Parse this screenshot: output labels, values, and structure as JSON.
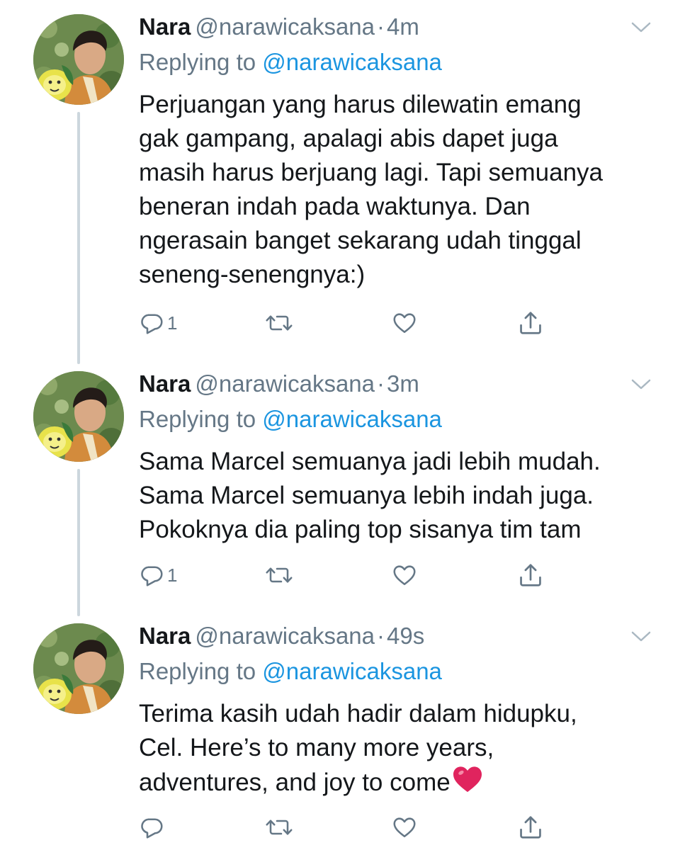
{
  "tweets": [
    {
      "name": "Nara",
      "handle": "@narawicaksana",
      "separator": "·",
      "time": "4m",
      "replying_prefix": "Replying to",
      "replying_to": "@narawicaksana",
      "lines": [
        "Perjuangan yang harus dilewatin emang",
        "gak gampang, apalagi abis dapet juga",
        "masih harus berjuang lagi. Tapi semuanya",
        "beneran indah pada waktunya. Dan",
        "ngerasain banget sekarang udah tinggal",
        "seneng-senengnya:)"
      ],
      "reply_count": "1"
    },
    {
      "name": "Nara",
      "handle": "@narawicaksana",
      "separator": "·",
      "time": "3m",
      "replying_prefix": "Replying to",
      "replying_to": "@narawicaksana",
      "lines": [
        "Sama Marcel semuanya jadi lebih mudah.",
        "Sama Marcel semuanya lebih indah juga.",
        "Pokoknya dia paling top sisanya tim tam"
      ],
      "reply_count": "1"
    },
    {
      "name": "Nara",
      "handle": "@narawicaksana",
      "separator": "·",
      "time": "49s",
      "replying_prefix": "Replying to",
      "replying_to": "@narawicaksana",
      "lines": [
        "Terima kasih udah hadir dalam hidupku,",
        "Cel. Here’s to many more years,",
        "adventures, and joy to come"
      ],
      "reply_count": ""
    }
  ],
  "icons": {
    "reply": "reply-icon",
    "retweet": "retweet-icon",
    "like": "heart-icon",
    "share": "share-icon",
    "caret": "chevron-down-icon",
    "emoji": "red-heart-emoji"
  },
  "colors": {
    "text": "#14171a",
    "secondary": "#657786",
    "link": "#1b95e0",
    "thread_line": "#ccd6dd",
    "emoji_heart": "#e0245e"
  }
}
